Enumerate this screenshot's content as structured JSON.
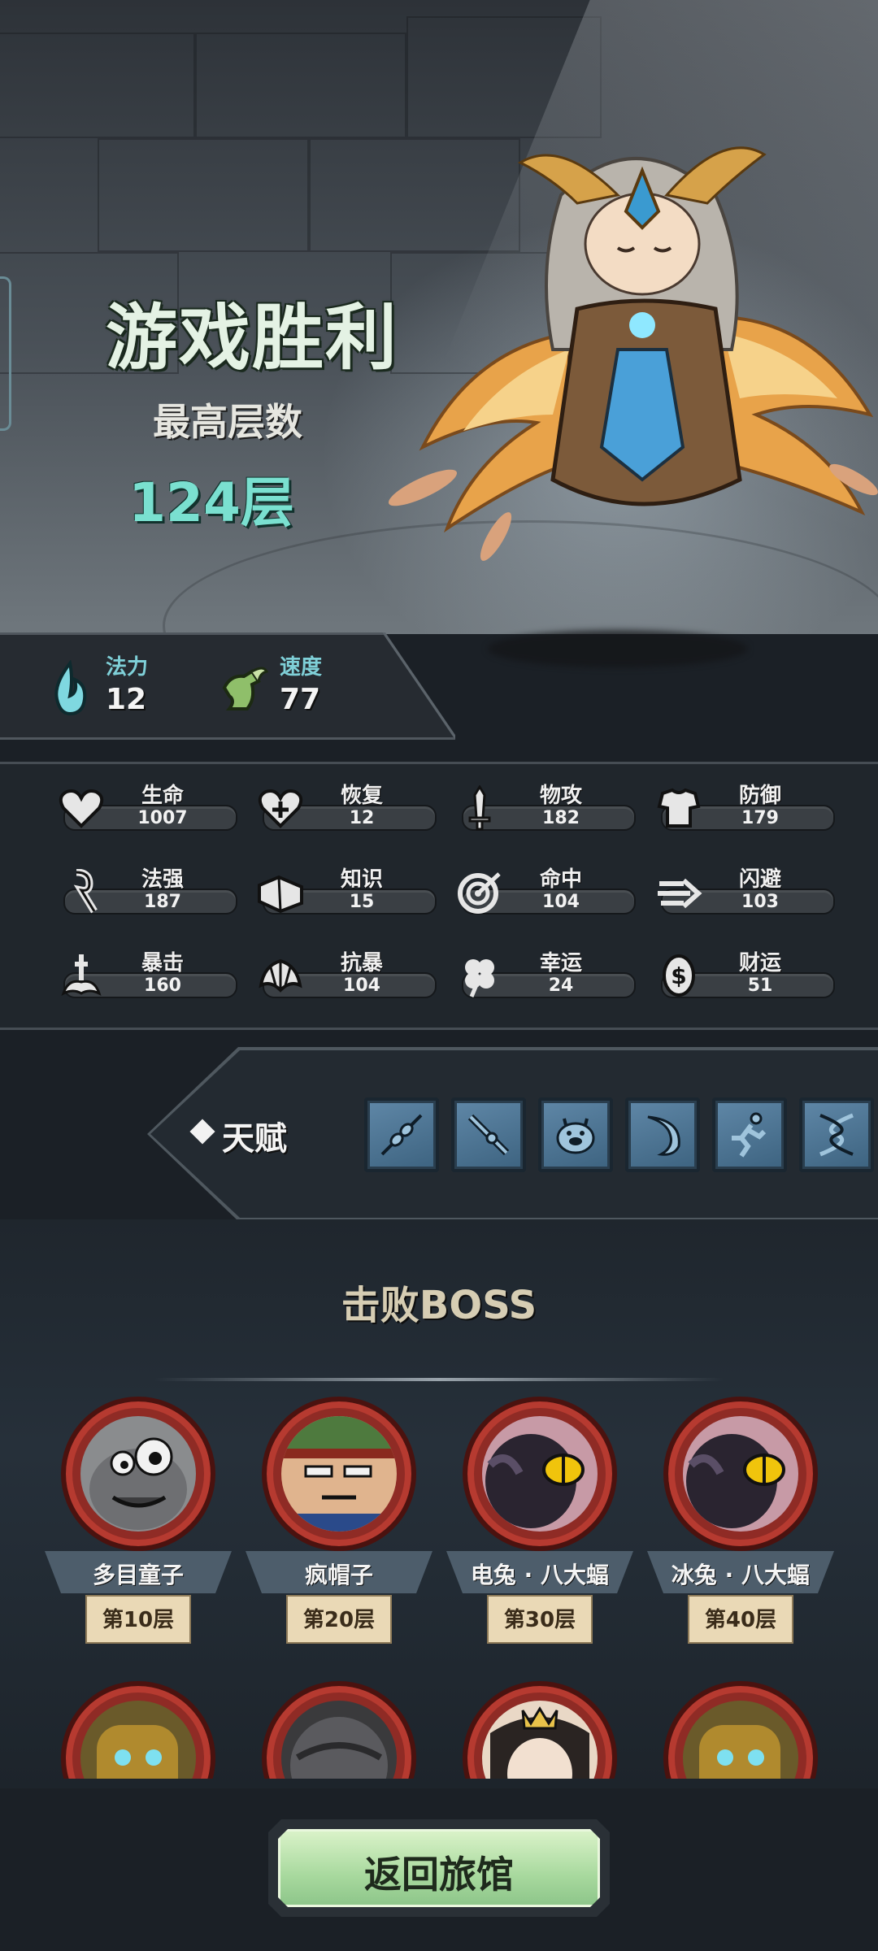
{
  "result": {
    "title": "游戏胜利",
    "best_floor_label": "最高层数",
    "best_floor_value": "124层"
  },
  "primary_stats": [
    {
      "label": "法力",
      "value": "12",
      "icon": "blue-flame-icon"
    },
    {
      "label": "速度",
      "value": "77",
      "icon": "winged-boot-icon"
    }
  ],
  "stats": [
    {
      "label": "生命",
      "value": "1007",
      "icon": "heart-icon"
    },
    {
      "label": "恢复",
      "value": "12",
      "icon": "heart-plus-icon"
    },
    {
      "label": "物攻",
      "value": "182",
      "icon": "sword-icon"
    },
    {
      "label": "防御",
      "value": "179",
      "icon": "armor-icon"
    },
    {
      "label": "法强",
      "value": "187",
      "icon": "magic-staff-icon"
    },
    {
      "label": "知识",
      "value": "15",
      "icon": "book-icon"
    },
    {
      "label": "命中",
      "value": "104",
      "icon": "target-icon"
    },
    {
      "label": "闪避",
      "value": "103",
      "icon": "dash-arrow-icon"
    },
    {
      "label": "暴击",
      "value": "160",
      "icon": "crit-dagger-icon"
    },
    {
      "label": "抗暴",
      "value": "104",
      "icon": "shell-shield-icon"
    },
    {
      "label": "幸运",
      "value": "24",
      "icon": "clover-icon"
    },
    {
      "label": "财运",
      "value": "51",
      "icon": "coin-icon"
    }
  ],
  "talent": {
    "label": "天赋",
    "slots": [
      "skewer-talent-icon",
      "staff-talent-icon",
      "pig-talent-icon",
      "crescent-talent-icon",
      "runner-talent-icon",
      "dna-talent-icon"
    ]
  },
  "bosses": {
    "title": "击败BOSS",
    "items": [
      {
        "name": "多目童子",
        "floor": "第10层"
      },
      {
        "name": "疯帽子",
        "floor": "第20层"
      },
      {
        "name": "电兔 · 八大蝠",
        "floor": "第30层"
      },
      {
        "name": "冰兔 · 八大蝠",
        "floor": "第40层"
      }
    ]
  },
  "return_button": "返回旅馆",
  "colors": {
    "accent_cyan": "#7ae0d0",
    "talent_blue": "#5f87a7",
    "boss_frame_red": "#8f2b25",
    "button_green": "#a8d99e"
  }
}
